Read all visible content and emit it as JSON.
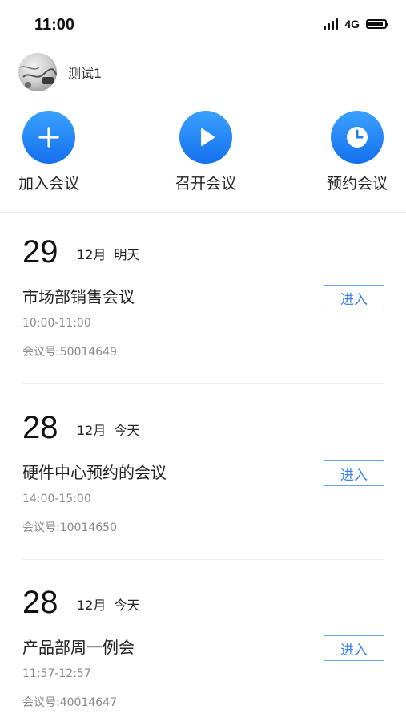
{
  "status_bar": {
    "time": "11:00",
    "network": "4G"
  },
  "profile": {
    "username": "测试1"
  },
  "actions": [
    {
      "label": "加入会议",
      "icon": "plus-icon"
    },
    {
      "label": "召开会议",
      "icon": "play-icon"
    },
    {
      "label": "预约会议",
      "icon": "clock-icon"
    }
  ],
  "meetings": [
    {
      "day": "29",
      "month": "12月",
      "relative": "明天",
      "title": "市场部销售会议",
      "time": "10:00-11:00",
      "meeting_id": "会议号:50014649",
      "enter_label": "进入"
    },
    {
      "day": "28",
      "month": "12月",
      "relative": "今天",
      "title": "硬件中心预约的会议",
      "time": "14:00-15:00",
      "meeting_id": "会议号:10014650",
      "enter_label": "进入"
    },
    {
      "day": "28",
      "month": "12月",
      "relative": "今天",
      "title": "产品部周一例会",
      "time": "11:57-12:57",
      "meeting_id": "会议号:40014647",
      "enter_label": "进入"
    }
  ],
  "colors": {
    "accent": "#1f7ff0",
    "button_border": "#6aa6ee",
    "secondary_text": "#8a8a8a"
  }
}
